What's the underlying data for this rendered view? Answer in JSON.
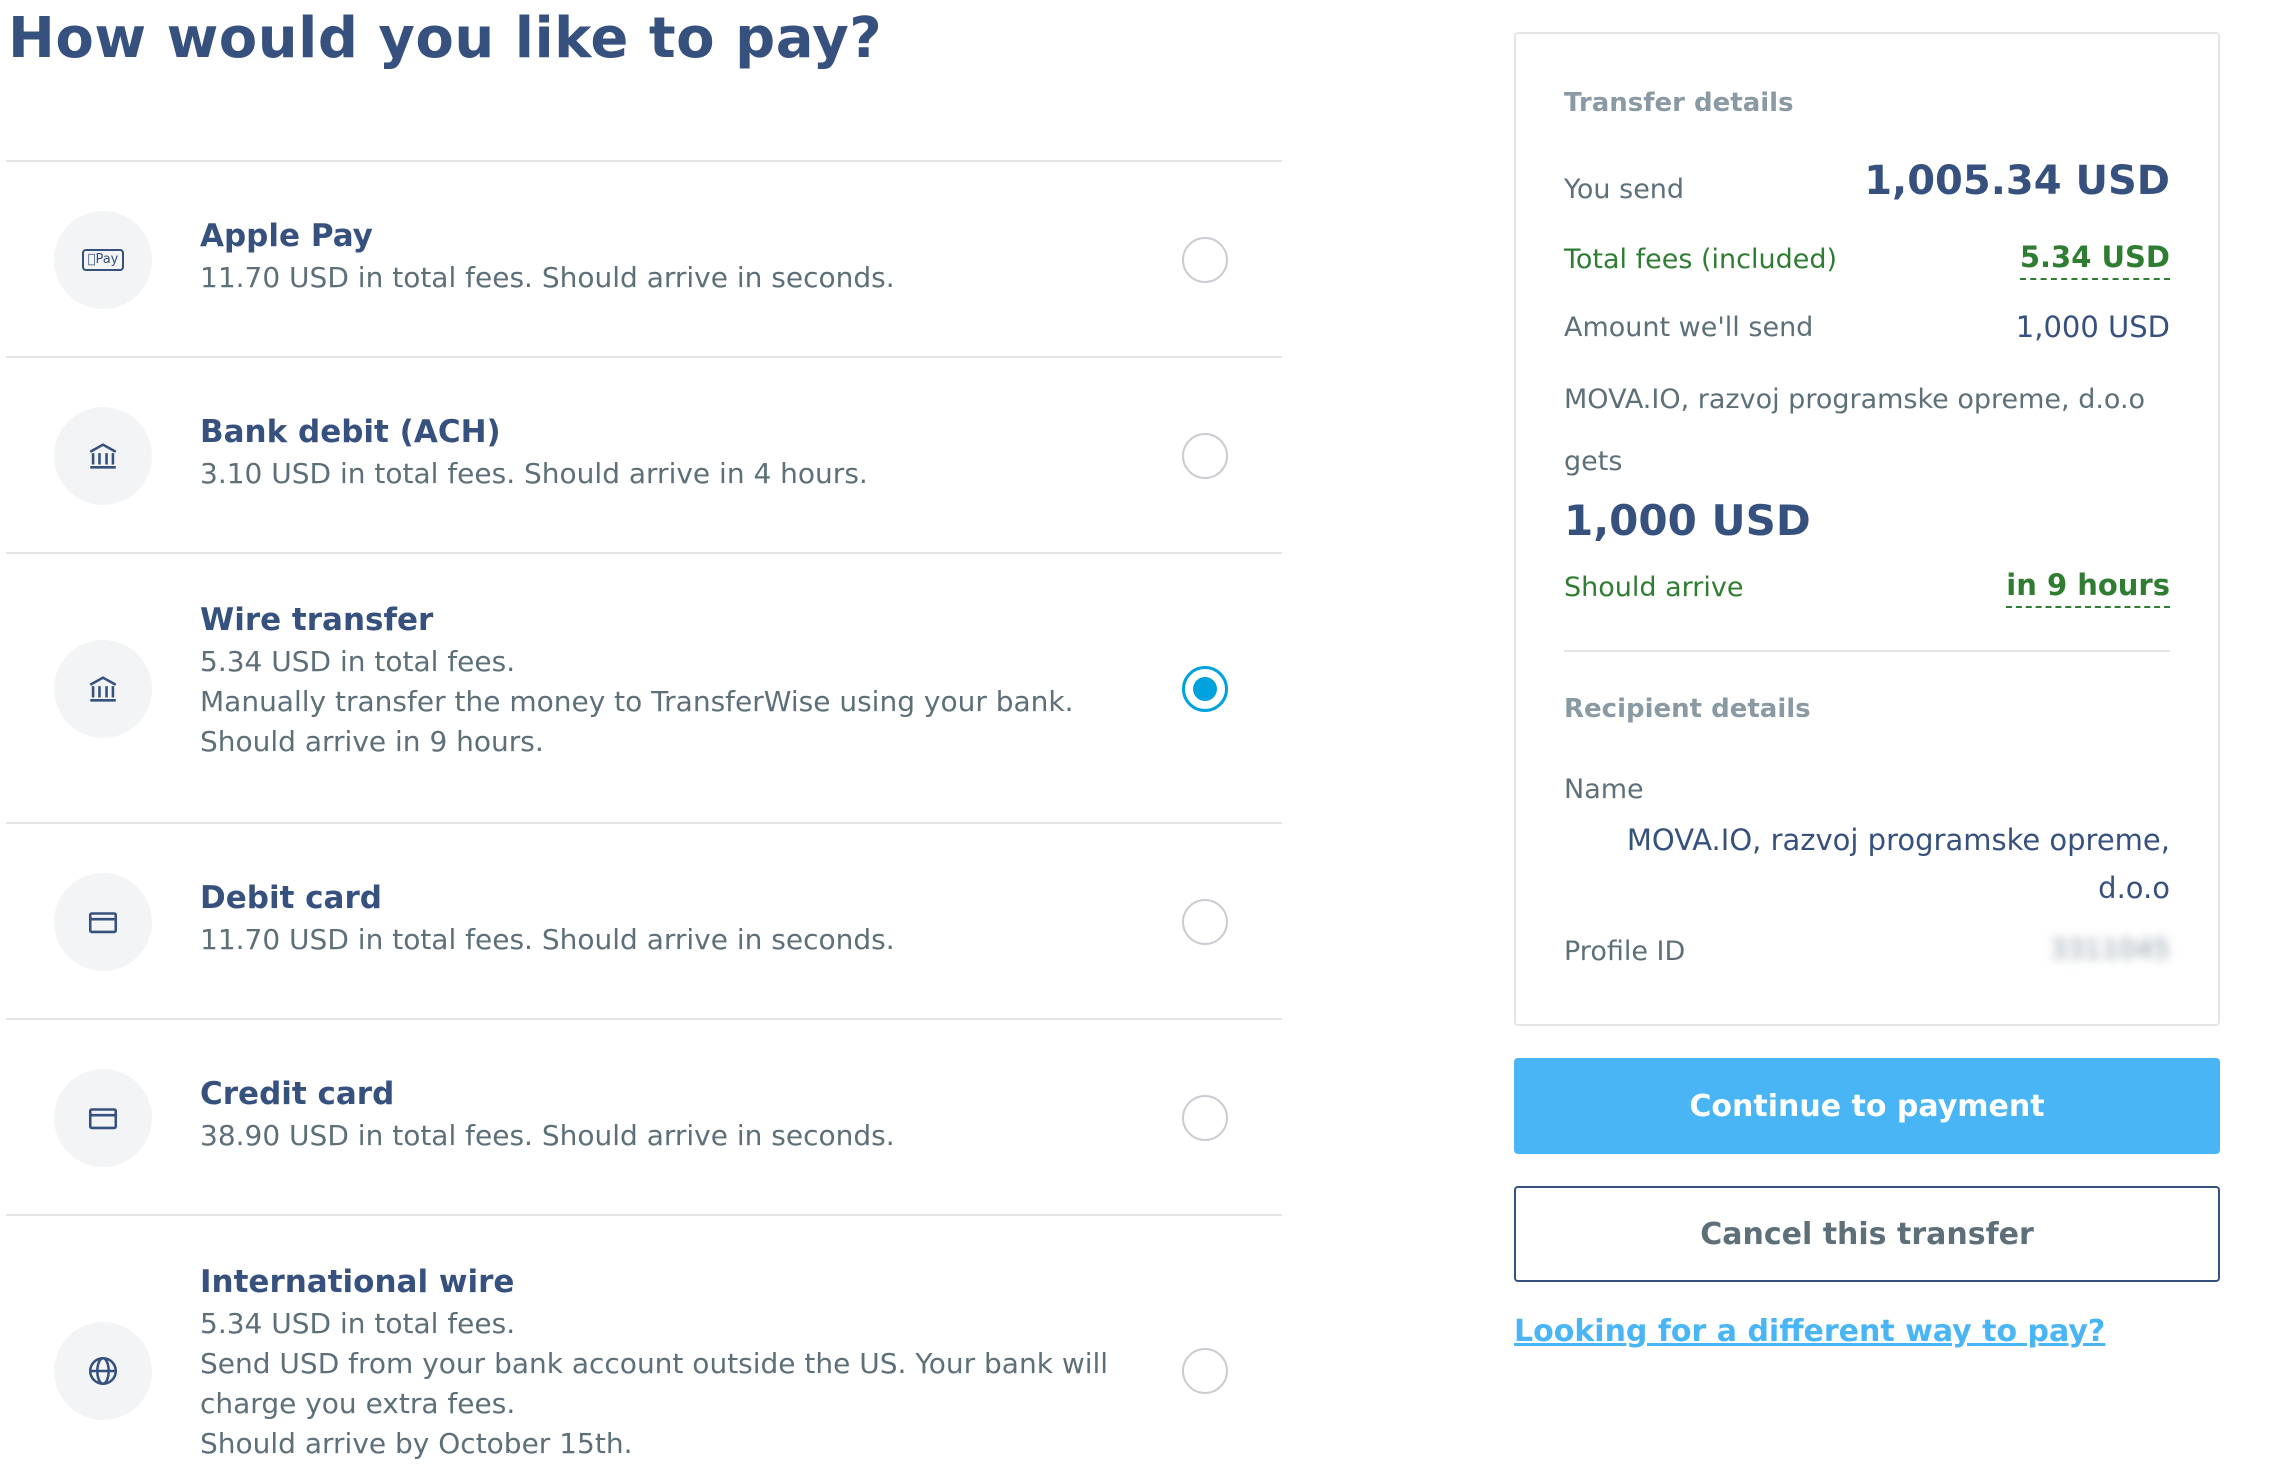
{
  "page": {
    "title": "How would you like to pay?"
  },
  "methods": [
    {
      "title": "Apple Pay",
      "lines": [
        "11.70 USD in total fees. Should arrive in seconds."
      ],
      "icon": "apple-pay-icon",
      "badge": "Pay",
      "selected": false
    },
    {
      "title": "Bank debit (ACH)",
      "lines": [
        "3.10 USD in total fees. Should arrive in 4 hours."
      ],
      "icon": "bank-icon",
      "selected": false
    },
    {
      "title": "Wire transfer",
      "lines": [
        "5.34 USD in total fees.",
        "Manually transfer the money to TransferWise using your bank.",
        "Should arrive in 9 hours."
      ],
      "icon": "bank-icon",
      "selected": true
    },
    {
      "title": "Debit card",
      "lines": [
        "11.70 USD in total fees. Should arrive in seconds."
      ],
      "icon": "card-icon",
      "selected": false
    },
    {
      "title": "Credit card",
      "lines": [
        "38.90 USD in total fees. Should arrive in seconds."
      ],
      "icon": "card-icon",
      "selected": false
    },
    {
      "title": "International wire",
      "lines": [
        "5.34 USD in total fees.",
        "Send USD from your bank account outside the US. Your bank will",
        "charge you extra fees.",
        "Should arrive by October 15th."
      ],
      "icon": "globe-icon",
      "selected": false
    }
  ],
  "transfer": {
    "section_title": "Transfer details",
    "you_send_label": "You send",
    "you_send_value": "1,005.34 USD",
    "fees_label": "Total fees (included)",
    "fees_value": "5.34 USD",
    "amount_label": "Amount we'll send",
    "amount_value": "1,000 USD",
    "recipient_gets_line1": "MOVA.IO, razvoj programske opreme, d.o.o",
    "recipient_gets_line2": "gets",
    "gets_value": "1,000 USD",
    "arrive_label": "Should arrive",
    "arrive_value": "in 9 hours"
  },
  "recipient": {
    "section_title": "Recipient details",
    "name_label": "Name",
    "name_line1": "MOVA.IO, razvoj programske opreme,",
    "name_line2": "d.o.o",
    "profile_label": "Profile ID",
    "profile_value": "3311045"
  },
  "actions": {
    "continue_label": "Continue to payment",
    "cancel_label": "Cancel this transfer",
    "alt_link": "Looking for a different way to pay?"
  },
  "colors": {
    "accent": "#49b5f5",
    "radio_selected": "#00a2dd",
    "title": "#37517e",
    "positive": "#2f7d32"
  }
}
